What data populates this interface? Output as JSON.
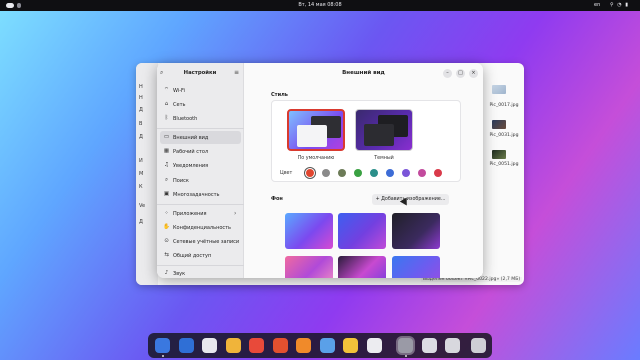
{
  "topbar": {
    "clock": "Вт, 14 мая  08:08",
    "language": "en",
    "system_icons": "⚲ ◔ ▮"
  },
  "files_window": {
    "sidebar_items": [
      "Н",
      "Н",
      "Д",
      "В",
      "Д",
      "И",
      "М",
      "К",
      "Ve",
      "Д"
    ],
    "files": [
      "Pic_0017.jpg",
      "Pic_0031.jpg",
      "Pic_0051.jpg"
    ],
    "status": "Выделен объект «Pic_0022.jpg» (2,7 МБ)"
  },
  "settings": {
    "sidebar_title": "Настройки",
    "items": [
      {
        "label": "Wi-Fi",
        "icon": "wifi-icon",
        "glyph": "⌔"
      },
      {
        "label": "Сеть",
        "icon": "network-icon",
        "glyph": "⌂"
      },
      {
        "label": "Bluetooth",
        "icon": "bluetooth-icon",
        "glyph": "ᛒ"
      },
      {
        "label": "Внешний вид",
        "icon": "appearance-icon",
        "glyph": "▭"
      },
      {
        "label": "Рабочий стол",
        "icon": "desktop-icon",
        "glyph": "▦"
      },
      {
        "label": "Уведомления",
        "icon": "bell-icon",
        "glyph": "♫"
      },
      {
        "label": "Поиск",
        "icon": "search-icon",
        "glyph": "⌕"
      },
      {
        "label": "Многозадачность",
        "icon": "multitasking-icon",
        "glyph": "▣"
      },
      {
        "label": "Приложения",
        "icon": "apps-icon",
        "glyph": "⁘"
      },
      {
        "label": "Конфиденциальность",
        "icon": "privacy-icon",
        "glyph": "✋"
      },
      {
        "label": "Сетевые учётные записи",
        "icon": "accounts-icon",
        "glyph": "⊙"
      },
      {
        "label": "Общий доступ",
        "icon": "sharing-icon",
        "glyph": "⇆"
      },
      {
        "label": "Звук",
        "icon": "sound-icon",
        "glyph": "♪"
      }
    ],
    "content_title": "Внешний вид",
    "style_label": "Стиль",
    "style_default": "По умолчанию",
    "style_dark": "Темный",
    "accent_label": "Цвет",
    "accent_colors": [
      "#e0452e",
      "#8a8a8a",
      "#6c7b57",
      "#3aa142",
      "#2b8f8a",
      "#3d6cd6",
      "#7b55d8",
      "#c24a9d",
      "#d93a4a"
    ],
    "background_label": "Фон",
    "add_image_button": "Добавить изображение...",
    "add_icon_glyph": "+"
  },
  "dock": {
    "icons": [
      "files-icon",
      "browser-icon",
      "mail-icon",
      "calendar-icon",
      "calendar2-icon",
      "office-icon",
      "presentation-icon",
      "photos-icon",
      "music-icon",
      "software-icon",
      "settings-icon",
      "monitor-icon",
      "trash-icon",
      "app-grid-icon"
    ]
  },
  "colors": {
    "accent": "#e0452e",
    "dock_bg": "#1c1c26"
  }
}
